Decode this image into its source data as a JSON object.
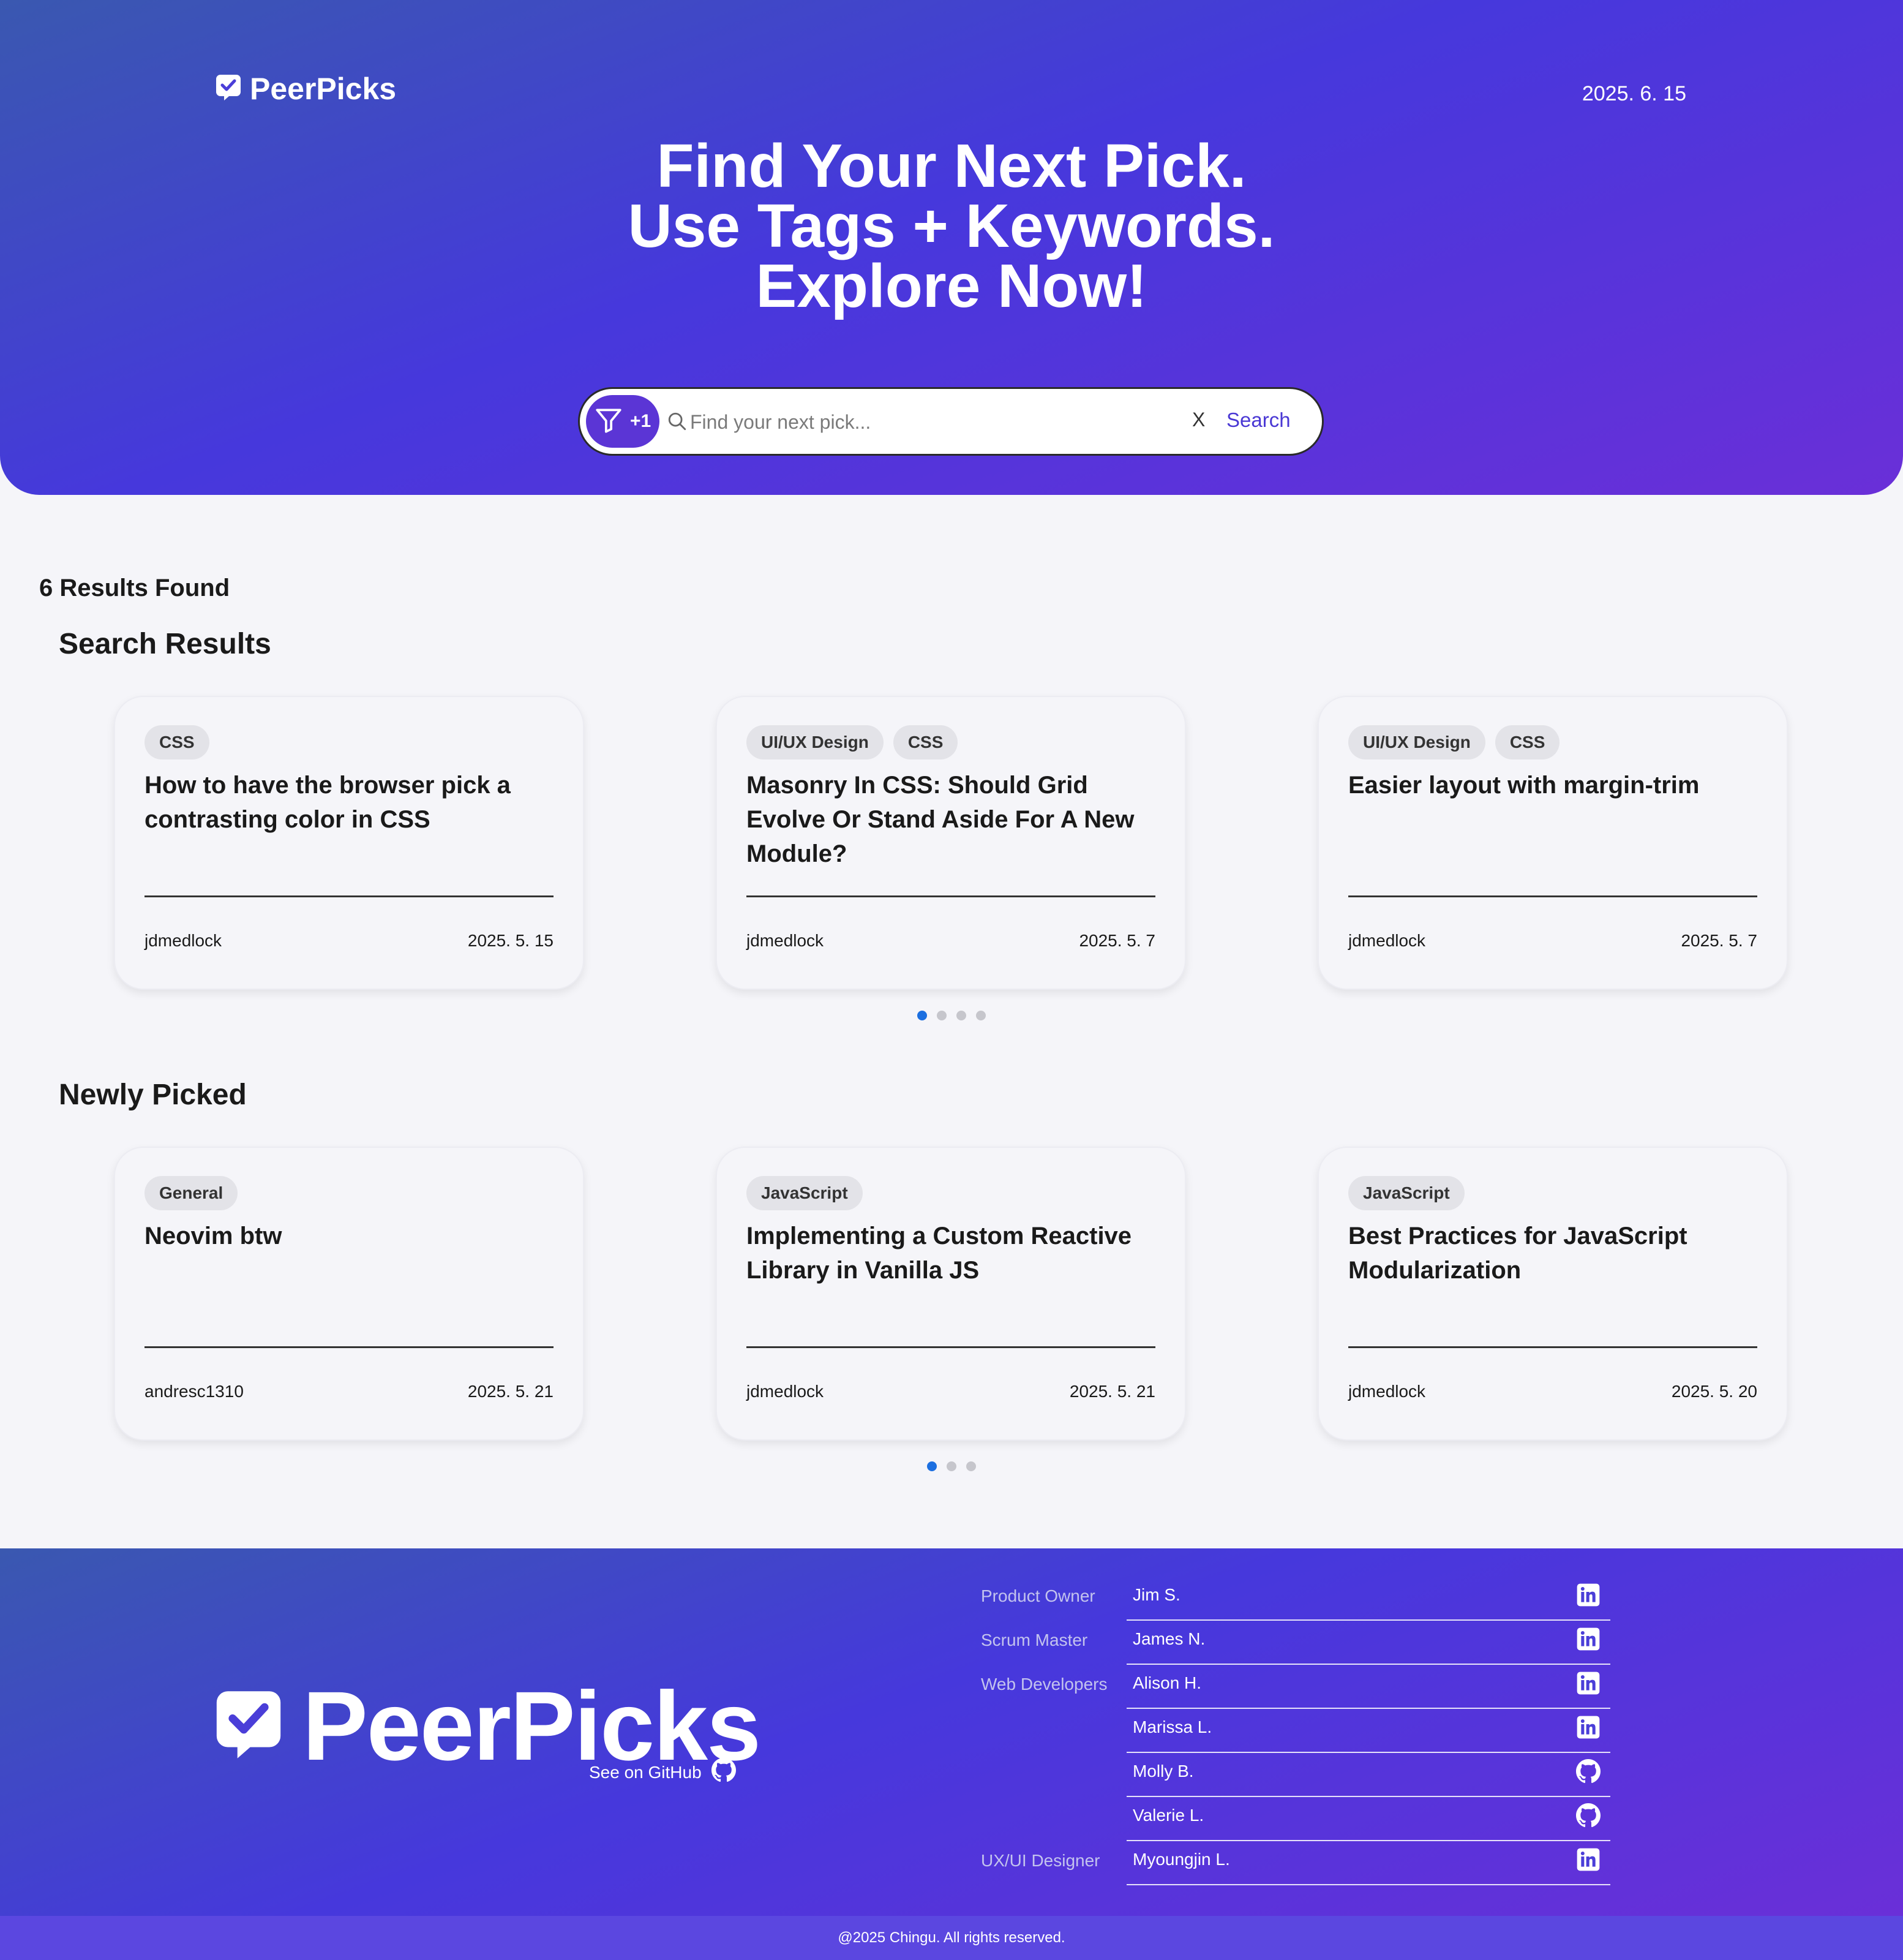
{
  "header": {
    "logo_text": "PeerPicks",
    "date": "2025. 6. 15",
    "headline": [
      "Find Your Next Pick.",
      "Use Tags + Keywords.",
      "Explore Now!"
    ]
  },
  "search": {
    "filter_count": "+1",
    "placeholder": "Find your next pick...",
    "value": "",
    "clear_label": "X",
    "submit_label": "Search"
  },
  "results": {
    "count_text": "6 Results Found",
    "section_title": "Search Results",
    "cards": [
      {
        "tags": [
          "CSS"
        ],
        "title": "How to have the browser pick a contrasting color in CSS",
        "author": "jdmedlock",
        "date": "2025. 5. 15"
      },
      {
        "tags": [
          "UI/UX Design",
          "CSS"
        ],
        "title": "Masonry In CSS: Should Grid Evolve Or Stand Aside For A New Module?",
        "author": "jdmedlock",
        "date": "2025. 5. 7"
      },
      {
        "tags": [
          "UI/UX Design",
          "CSS"
        ],
        "title": "Easier layout with margin-trim",
        "author": "jdmedlock",
        "date": "2025. 5. 7"
      }
    ],
    "pagination": {
      "pages": 4,
      "active": 1
    }
  },
  "newly_picked": {
    "section_title": "Newly Picked",
    "cards": [
      {
        "tags": [
          "General"
        ],
        "title": "Neovim btw",
        "author": "andresc1310",
        "date": "2025. 5. 21"
      },
      {
        "tags": [
          "JavaScript"
        ],
        "title": "Implementing a Custom Reactive Library in Vanilla JS",
        "author": "jdmedlock",
        "date": "2025. 5. 21"
      },
      {
        "tags": [
          "JavaScript"
        ],
        "title": "Best Practices for JavaScript Modularization",
        "author": "jdmedlock",
        "date": "2025. 5. 20"
      }
    ],
    "pagination": {
      "pages": 3,
      "active": 1
    }
  },
  "footer": {
    "logo_text": "PeerPicks",
    "github_label": "See on GitHub",
    "roles": [
      "Product Owner",
      "Scrum Master",
      "Web Developers",
      "UX/UI Designer"
    ],
    "team": [
      {
        "name": "Jim S.",
        "icon": "linkedin-icon"
      },
      {
        "name": "James N.",
        "icon": "linkedin-icon"
      },
      {
        "name": "Alison H.",
        "icon": "linkedin-icon"
      },
      {
        "name": "Marissa L.",
        "icon": "linkedin-icon"
      },
      {
        "name": "Molly B.",
        "icon": "github-icon"
      },
      {
        "name": "Valerie L.",
        "icon": "github-icon"
      },
      {
        "name": "Myoungjin L.",
        "icon": "linkedin-icon"
      }
    ],
    "copyright": "@2025 Chingu. All rights reserved."
  },
  "colors": {
    "accent": "#5b35d5",
    "gradient_start": "#3a58b0",
    "gradient_mid": "#4638dc",
    "gradient_end": "#6a2fd8",
    "dot_active": "#1c6fe0",
    "dot_inactive": "#c6c6cc"
  }
}
